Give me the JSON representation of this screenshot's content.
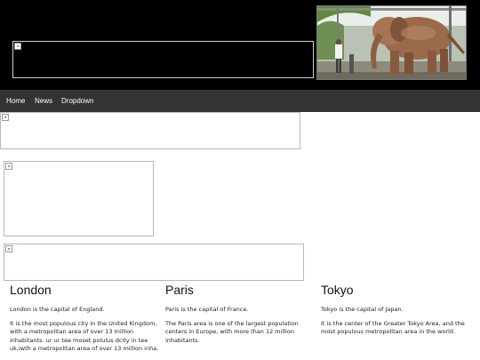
{
  "nav": {
    "items": [
      {
        "label": "Home"
      },
      {
        "label": "News"
      },
      {
        "label": "Dropdown"
      }
    ]
  },
  "colors": {
    "header_bg": "#000000",
    "navbar_bg": "#333333",
    "nav_text": "#ffffff"
  },
  "cities": [
    {
      "name": "London",
      "paragraphs": [
        "London is the capital of England.",
        "It is the most populous city in the United Kingdom, with a metropolitan area of over 13 million inhabitants. ur ur tee moset polulus dcity in tee uk,iwth a metropolitan area of over 13 million inha."
      ]
    },
    {
      "name": "Paris",
      "paragraphs": [
        "Paris is the capital of France.",
        "The Paris area is one of the largest population centers in Europe, with more than 12 million inhabitants."
      ]
    },
    {
      "name": "Tokyo",
      "paragraphs": [
        "Tokyo is the capital of Japan.",
        "It is the center of the Greater Tokyo Area, and the most populous metropolitan area in the world."
      ]
    }
  ]
}
